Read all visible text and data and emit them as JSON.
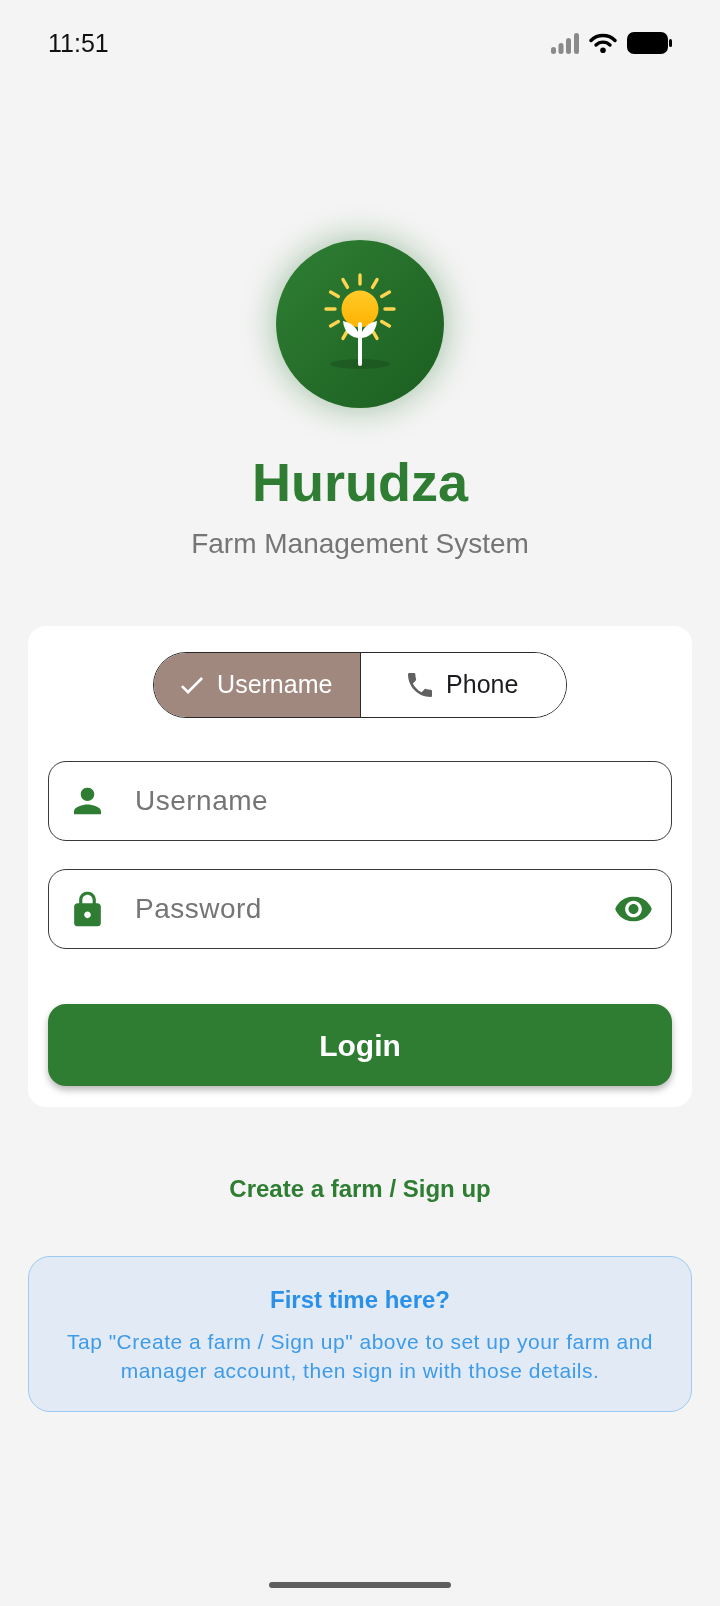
{
  "status_bar": {
    "time": "11:51"
  },
  "header": {
    "title": "Hurudza",
    "subtitle": "Farm Management System"
  },
  "login_mode": [
    {
      "label": "Username",
      "kind": "username",
      "selected": true
    },
    {
      "label": "Phone",
      "kind": "phone",
      "selected": false
    }
  ],
  "fields": [
    {
      "kind": "username",
      "placeholder": "Username"
    },
    {
      "kind": "password",
      "placeholder": "Password"
    }
  ],
  "login_button": {
    "label": "Login"
  },
  "signup_link": {
    "label": "Create a farm / Sign up"
  },
  "info": {
    "title": "First time here?",
    "text": "Tap \"Create a farm / Sign up\" above to set up your farm and manager account, then sign in with those details."
  }
}
